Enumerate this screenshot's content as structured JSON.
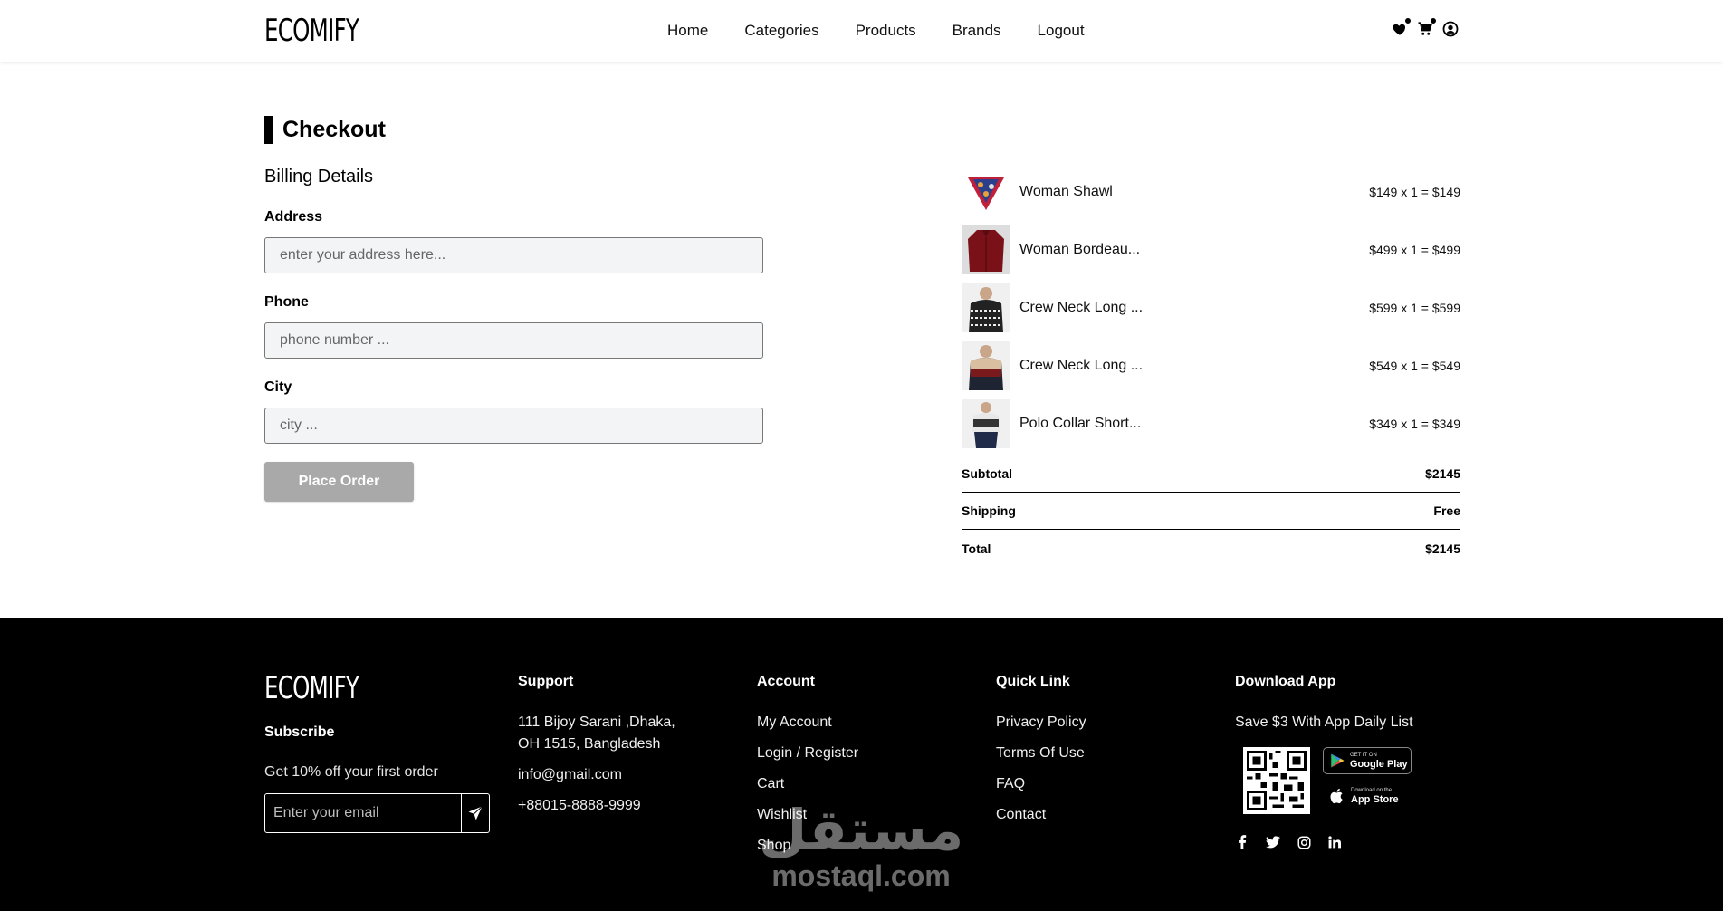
{
  "brand": {
    "name": "ECOMIFY"
  },
  "nav": {
    "links": [
      "Home",
      "Categories",
      "Products",
      "Brands",
      "Logout"
    ],
    "icons": [
      "heart-icon",
      "cart-icon",
      "user-icon"
    ]
  },
  "checkout": {
    "title": "Checkout",
    "billing_title": "Billing Details",
    "fields": [
      {
        "label": "Address",
        "placeholder": "enter your address here..."
      },
      {
        "label": "Phone",
        "placeholder": "phone number ..."
      },
      {
        "label": "City",
        "placeholder": "city ..."
      }
    ],
    "submit_label": "Place Order"
  },
  "order": {
    "items": [
      {
        "name": "Woman Shawl",
        "price": "$149 x 1 = $149"
      },
      {
        "name": "Woman Bordeau...",
        "price": "$499 x 1 = $499"
      },
      {
        "name": "Crew Neck Long ...",
        "price": "$599 x 1 = $599"
      },
      {
        "name": "Crew Neck Long ...",
        "price": "$549 x 1 = $549"
      },
      {
        "name": "Polo Collar Short...",
        "price": "$349 x 1 = $349"
      }
    ],
    "totals": [
      {
        "label": "Subtotal",
        "value": "$2145"
      },
      {
        "label": "Shipping",
        "value": "Free"
      },
      {
        "label": "Total",
        "value": "$2145"
      }
    ]
  },
  "footer": {
    "logo": "ECOMIFY",
    "subscribe_title": "Subscribe",
    "subscribe_text": "Get 10% off your first order",
    "email_placeholder": "Enter your email",
    "support": {
      "title": "Support",
      "address_line1": "111 Bijoy Sarani ,Dhaka,",
      "address_line2": "OH 1515, Bangladesh",
      "email": "info@gmail.com",
      "phone": "+88015-8888-9999"
    },
    "account": {
      "title": "Account",
      "links": [
        "My Account",
        "Login / Register",
        "Cart",
        "Wishlist",
        "Shop"
      ]
    },
    "quick_link": {
      "title": "Quick Link",
      "links": [
        "Privacy Policy",
        "Terms Of Use",
        "FAQ",
        "Contact"
      ]
    },
    "download": {
      "title": "Download App",
      "text": "Save $3 With App Daily List",
      "google_small": "GET IT ON",
      "google_big": "Google Play",
      "apple_small": "Download on the",
      "apple_big": "App Store"
    },
    "socials": [
      "facebook-icon",
      "twitter-icon",
      "instagram-icon",
      "linkedin-icon"
    ]
  },
  "watermark": {
    "arabic": "مستقل",
    "latin": "mostaql.com"
  }
}
